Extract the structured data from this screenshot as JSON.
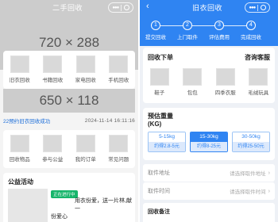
{
  "left": {
    "header": {
      "title": "二手回收"
    },
    "banner": {
      "placeholder": "720 × 288"
    },
    "categories": [
      {
        "label": "旧衣回收"
      },
      {
        "label": "书籍回收"
      },
      {
        "label": "家电回收"
      },
      {
        "label": "手机回收"
      }
    ],
    "banner2": {
      "placeholder": "650 × 118"
    },
    "ticker": {
      "message": "22预约旧衣回收成功",
      "time": "2024-11-14 16:11:16"
    },
    "quick_links": [
      {
        "label": "回收物品"
      },
      {
        "label": "参与公益"
      },
      {
        "label": "我的订单"
      },
      {
        "label": "常见问题"
      }
    ],
    "charity": {
      "title": "公益活动",
      "tag": "正在进行中",
      "desc_line1": "用衣份爱，送一片林,献一",
      "desc_line2": "份爱心"
    }
  },
  "right": {
    "header": {
      "back_icon": "chevron-left-icon",
      "title": "旧衣回收"
    },
    "steps": [
      {
        "num": "1",
        "label": "提交回收"
      },
      {
        "num": "2",
        "label": "上门取件"
      },
      {
        "num": "3",
        "label": "评估费用"
      },
      {
        "num": "4",
        "label": "完成回收"
      }
    ],
    "order": {
      "title": "回收下单",
      "service_link": "咨询客服",
      "items": [
        {
          "label": "鞋子"
        },
        {
          "label": "包包"
        },
        {
          "label": "四季衣服"
        },
        {
          "label": "毛绒玩具"
        }
      ]
    },
    "weight": {
      "title": "预估重量(KG)",
      "options": [
        {
          "range": "5-15kg",
          "price": "约得2.8-5元",
          "selected": false
        },
        {
          "range": "15-30kg",
          "price": "约得8-25元",
          "selected": true
        },
        {
          "range": "30-50kg",
          "price": "约得25-50元",
          "selected": false
        }
      ]
    },
    "fields": [
      {
        "label": "取件地址",
        "placeholder": "请选择取件地址"
      },
      {
        "label": "取件时间",
        "placeholder": "请选择取件时间"
      }
    ],
    "remark": {
      "label": "回收备注"
    }
  },
  "colors": {
    "brand_blue": "#2f84f2",
    "tag_green": "#17b56b",
    "ticker_blue": "#1e6fd9",
    "placeholder_gray": "#cccccc"
  }
}
